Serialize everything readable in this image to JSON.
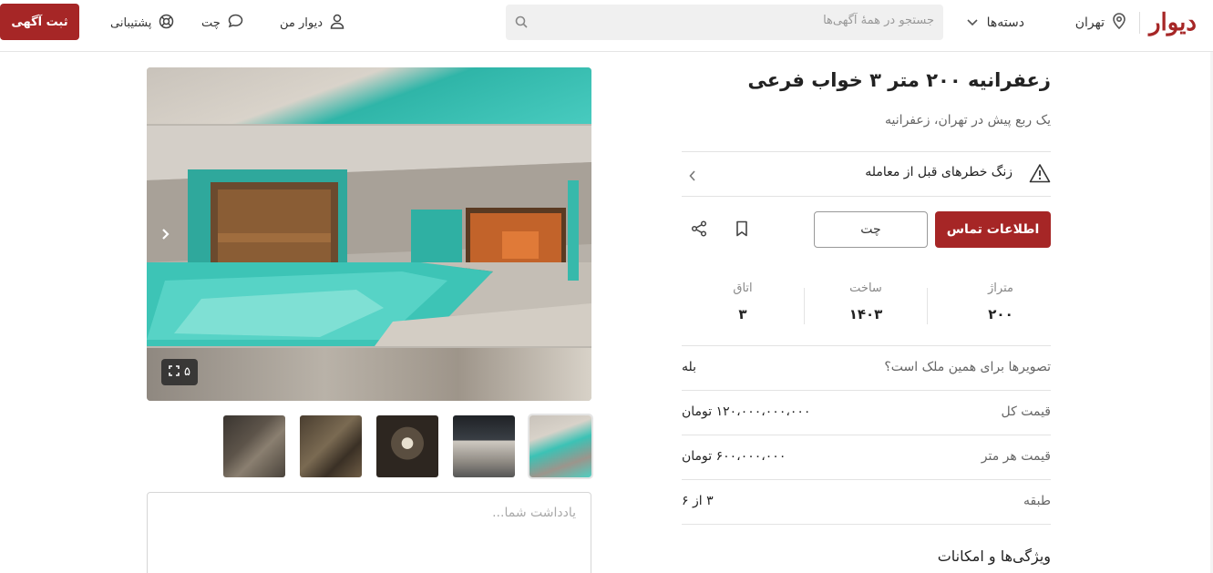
{
  "header": {
    "logo": "دیوار",
    "city": "تهران",
    "categories": "دسته‌ها",
    "search_placeholder": "جستجو در همهٔ آگهی‌ها",
    "my_divar": "دیوار من",
    "chat": "چت",
    "support": "پشتیبانی",
    "post_ad": "ثبت آگهی"
  },
  "listing": {
    "title": "زعفرانیه ۲۰۰ متر ۳ خواب فرعی",
    "subtitle": "یک ربع پیش در تهران، زعفرانیه",
    "warning": "زنگ خطرهای قبل از معامله",
    "contact_button": "اطلاعات تماس",
    "chat_button": "چت",
    "stats": [
      {
        "label": "متراژ",
        "value": "۲۰۰"
      },
      {
        "label": "ساخت",
        "value": "۱۴۰۳"
      },
      {
        "label": "اتاق",
        "value": "۳"
      }
    ],
    "rows": [
      {
        "label": "تصویرها برای همین ملک است؟",
        "value": "بله"
      },
      {
        "label": "قیمت کل",
        "value": "۱۲۰،۰۰۰،۰۰۰،۰۰۰ تومان"
      },
      {
        "label": "قیمت هر متر",
        "value": "۶۰۰،۰۰۰،۰۰۰ تومان"
      },
      {
        "label": "طبقه",
        "value": "۳ از ۶"
      }
    ],
    "features_heading": "ویژگی‌ها و امکانات"
  },
  "gallery": {
    "image_count": "۵",
    "note_placeholder": "یادداشت شما..."
  },
  "colors": {
    "brand": "#a62626",
    "pool": "#3cc2b5"
  }
}
